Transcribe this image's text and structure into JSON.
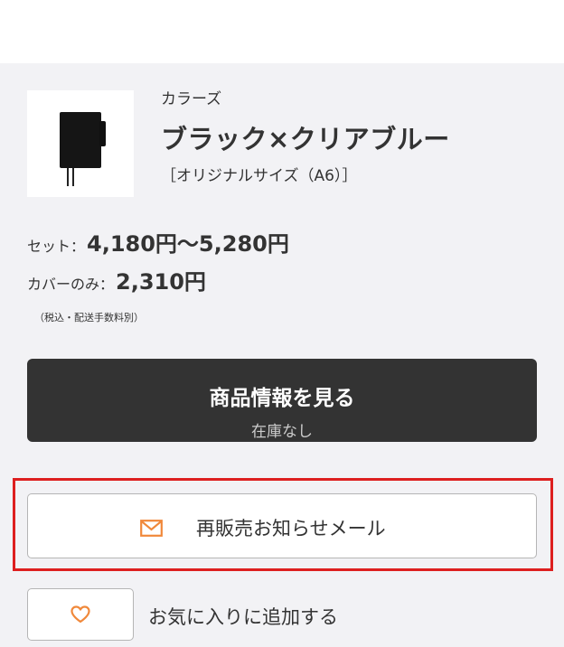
{
  "product": {
    "colors_label": "カラーズ",
    "name": "ブラック×クリアブルー",
    "size": "［オリジナルサイズ（A6）］"
  },
  "pricing": {
    "set_label": "セット：",
    "set_value": "4,180円〜5,280円",
    "cover_label": "カバーのみ：",
    "cover_value": "2,310円",
    "tax_note": "（税込・配送手数料別）"
  },
  "detail_button": {
    "label": "商品情報を見る",
    "stock_status": "在庫なし"
  },
  "restock_button": {
    "label": "再販売お知らせメール",
    "icon": "mail-icon"
  },
  "favorite_button": {
    "label": "お気に入りに追加する",
    "icon": "heart-icon"
  },
  "colors": {
    "accent_orange": "#f0883a",
    "dark_button": "#333333",
    "highlight_red": "#dd1f1f"
  }
}
